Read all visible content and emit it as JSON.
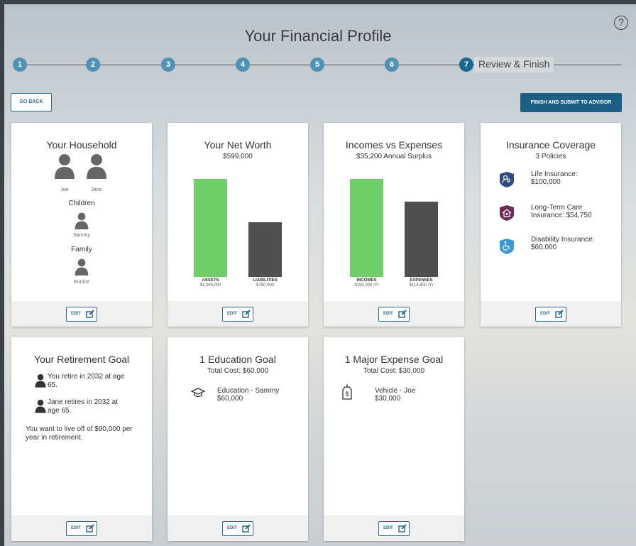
{
  "page": {
    "title": "Your Financial Profile",
    "help_glyph": "?"
  },
  "steps": [
    "1",
    "2",
    "3",
    "4",
    "5",
    "6",
    "7"
  ],
  "active_step_label": "Review & Finish",
  "buttons": {
    "go_back": "GO BACK",
    "finish": "FINISH AND SUBMIT TO ADVISOR",
    "edit": "EDIT"
  },
  "household": {
    "title": "Your Household",
    "adults": [
      "Joe",
      "Jane"
    ],
    "children_label": "Children",
    "children": [
      "Sammy"
    ],
    "family_label": "Family",
    "family": [
      "Eunice"
    ]
  },
  "net_worth": {
    "title": "Your Net Worth",
    "subtitle": "$599,000",
    "bars": [
      {
        "label": "ASSETS",
        "value_text": "$1,349,000",
        "value": 1349000,
        "color": "#6ecf68"
      },
      {
        "label": "LIABILITIES",
        "value_text": "$750,000",
        "value": 750000,
        "color": "#4f4f4f"
      }
    ]
  },
  "incomes": {
    "title": "Incomes vs Expenses",
    "subtitle": "$35,200 Annual Surplus",
    "bars": [
      {
        "label": "INCOMES",
        "value_text": "$150,000 /Yr",
        "value": 150000,
        "color": "#6ecf68"
      },
      {
        "label": "EXPENSES",
        "value_text": "$114,800 /Yr",
        "value": 114800,
        "color": "#4f4f4f"
      }
    ]
  },
  "insurance": {
    "title": "Insurance Coverage",
    "subtitle": "3 Policies",
    "policies": [
      {
        "text": "Life Insurance: $100,000",
        "icon": "people-shield-icon",
        "color": "#2c4a7a"
      },
      {
        "text": "Long-Term Care Insurance: $54,750",
        "icon": "house-heart-shield-icon",
        "color": "#6b2d55"
      },
      {
        "text": "Disability Insurance: $60,000",
        "icon": "wheelchair-shield-icon",
        "color": "#3a9ad6"
      }
    ]
  },
  "retirement": {
    "title": "Your Retirement Goal",
    "items": [
      "You retire in 2032 at age 65.",
      "Jane retires in 2032 at age 65."
    ],
    "summary": "You want to live off of $90,000 per year in retirement."
  },
  "education": {
    "title": "1 Education Goal",
    "subtitle": "Total Cost: $60,000",
    "goal_name": "Education - Sammy",
    "goal_amount": "$60,000"
  },
  "major_expense": {
    "title": "1 Major Expense Goal",
    "subtitle": "Total Cost: $30,000",
    "goal_name": "Vehicle - Joe",
    "goal_amount": "$30,000"
  }
}
